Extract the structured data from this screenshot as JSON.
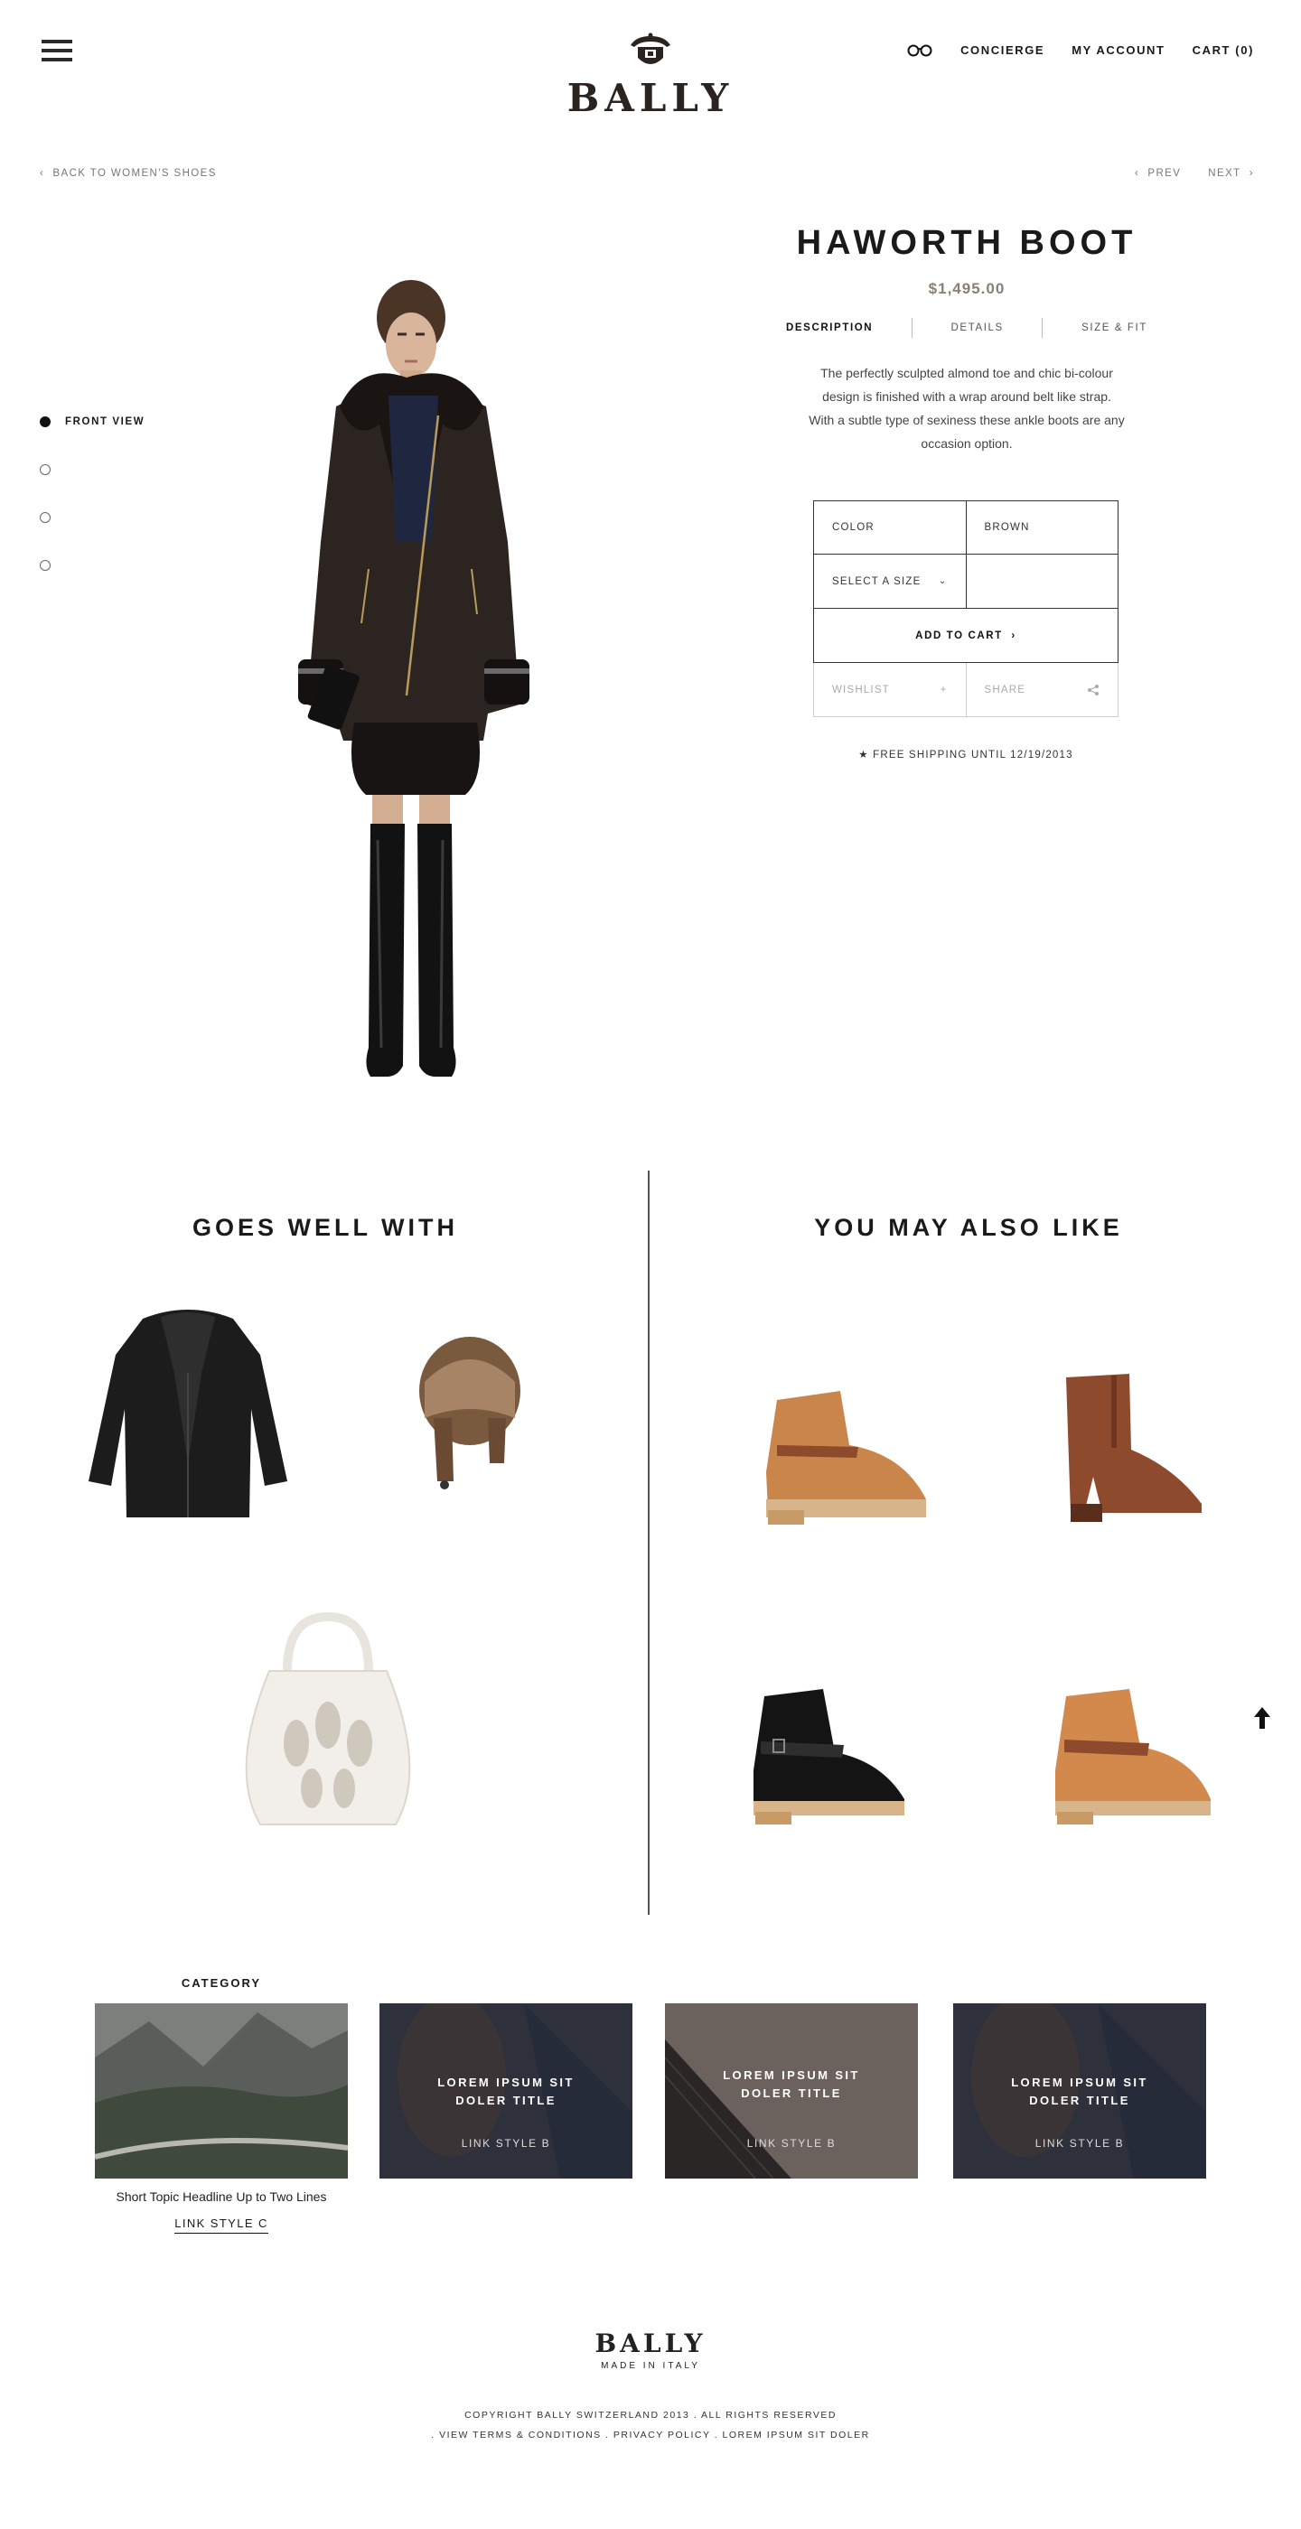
{
  "header": {
    "brand": "BALLY",
    "nav": [
      {
        "label": "CONCIERGE"
      },
      {
        "label": "MY ACCOUNT"
      },
      {
        "label": "CART (0)"
      }
    ]
  },
  "breadcrumb": {
    "back": "BACK TO WOMEN'S SHOES",
    "prev": "PREV",
    "next": "NEXT"
  },
  "views": [
    {
      "label": "FRONT VIEW",
      "active": true
    },
    {
      "label": "",
      "active": false
    },
    {
      "label": "",
      "active": false
    },
    {
      "label": "",
      "active": false
    }
  ],
  "product": {
    "title": "HAWORTH BOOT",
    "price": "$1,495.00",
    "tabs": [
      "DESCRIPTION",
      "DETAILS",
      "SIZE & FIT"
    ],
    "description": "The perfectly sculpted almond toe and chic bi-colour design is finished with a wrap around belt like strap. With a subtle type of sexiness these ankle boots are any occasion option.",
    "color_label": "COLOR",
    "color_value": "BROWN",
    "size_select": "SELECT A SIZE",
    "add_to_cart": "ADD TO CART",
    "wishlist": "WISHLIST",
    "wishlist_symbol": "+",
    "share": "SHARE",
    "shipping": "★ FREE SHIPPING UNTIL 12/19/2013"
  },
  "goes_well_with": {
    "title": "GOES WELL WITH"
  },
  "you_may_also_like": {
    "title": "YOU MAY ALSO LIKE"
  },
  "category": {
    "label": "CATEGORY",
    "headline": "Short Topic Headline Up to Two Lines",
    "link": "LINK STYLE C",
    "cards": [
      {
        "title": "LOREM IPSUM SIT DOLER TITLE",
        "link": "LINK STYLE B"
      },
      {
        "title": "LOREM IPSUM SIT DOLER TITLE",
        "link": "LINK STYLE B"
      },
      {
        "title": "LOREM IPSUM SIT DOLER TITLE",
        "link": "LINK STYLE B"
      }
    ]
  },
  "footer": {
    "brand": "BALLY",
    "tagline": "MADE IN ITALY",
    "copyright": "COPYRIGHT BALLY SWITZERLAND 2013 . ALL RIGHTS RESERVED",
    "links": ". VIEW TERMS & CONDITIONS . PRIVACY POLICY . LOREM IPSUM SIT DOLER"
  },
  "colors": {
    "text": "#1a1a1a",
    "price": "#8a7f75",
    "brand": "#2b2320",
    "tan_leather": "#c9854a",
    "brown_leather": "#8e4a2c"
  }
}
